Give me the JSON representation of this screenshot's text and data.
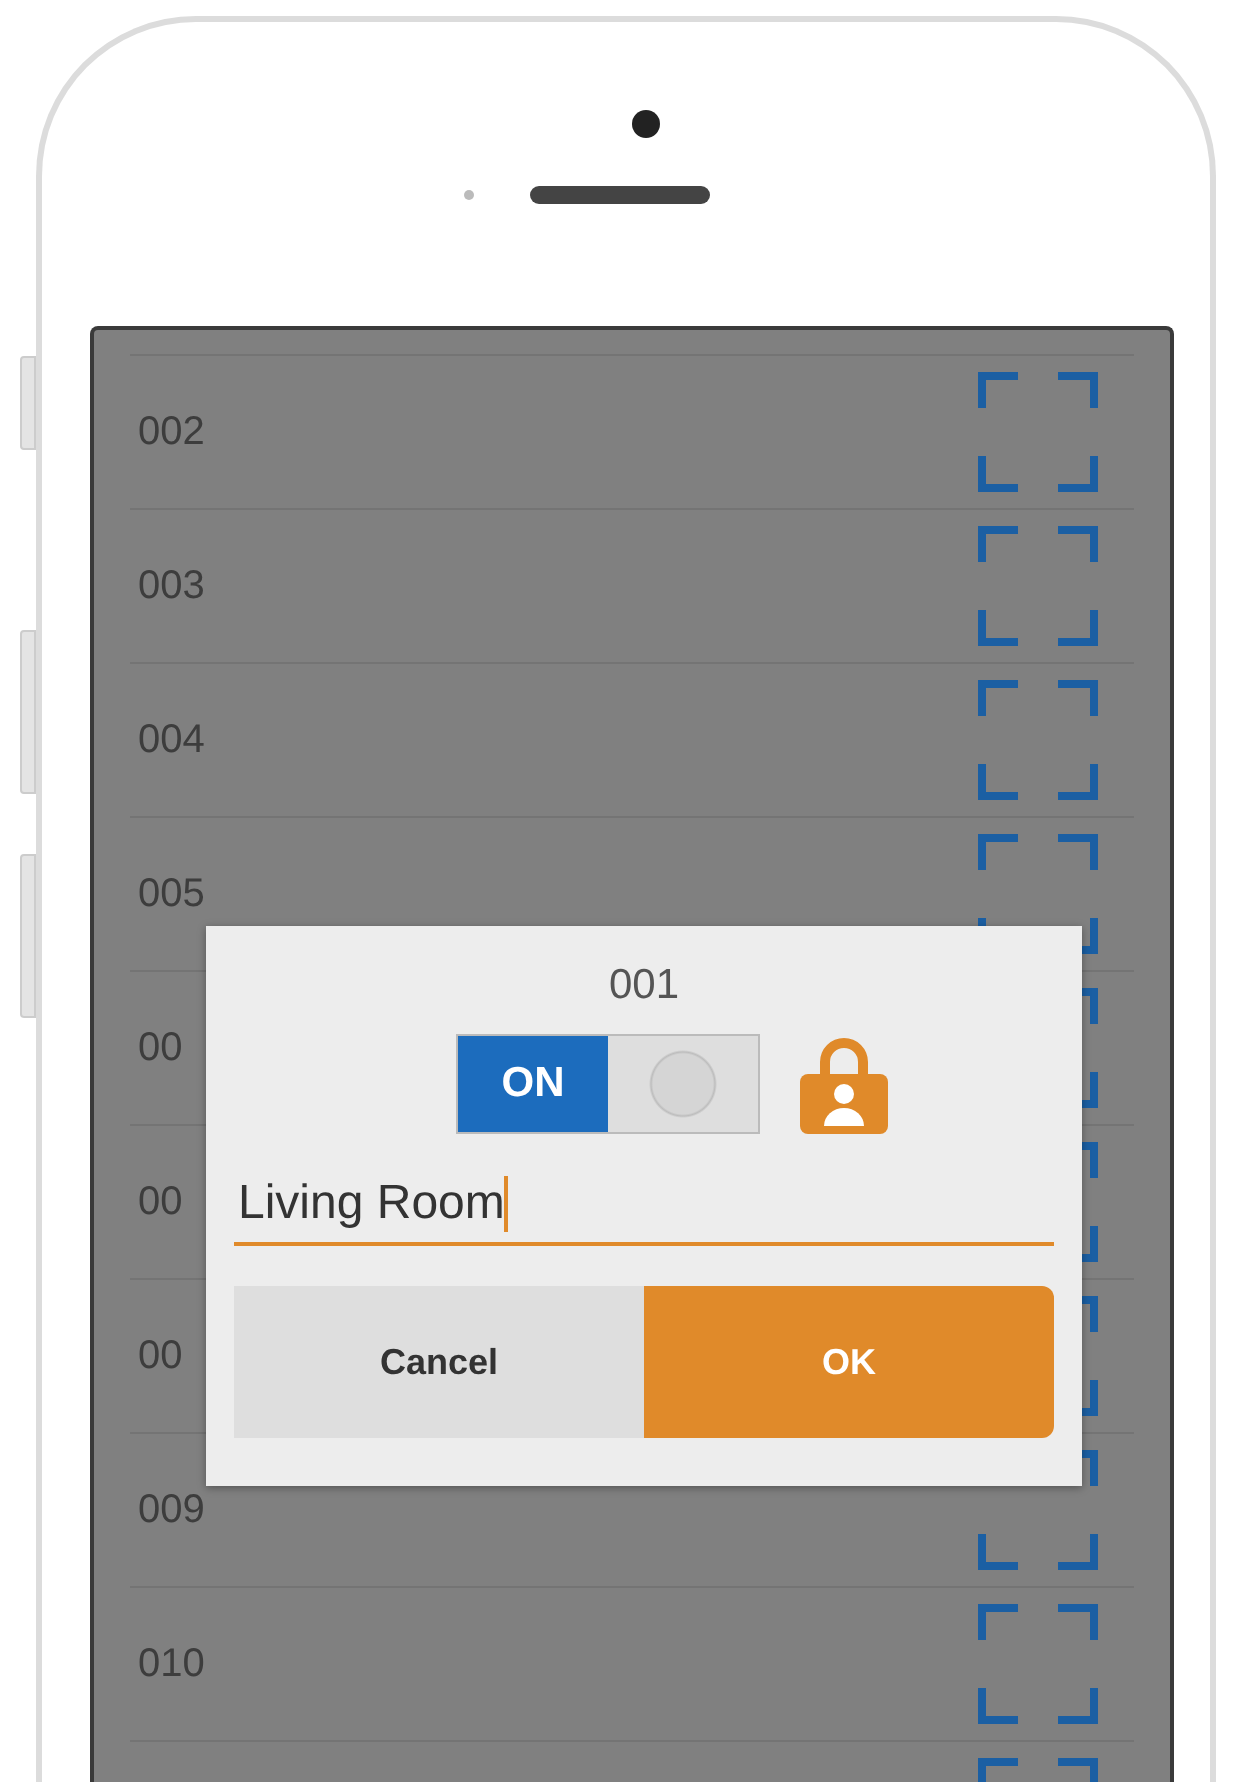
{
  "list": {
    "rows": [
      {
        "label": "002"
      },
      {
        "label": "003"
      },
      {
        "label": "004"
      },
      {
        "label": "005"
      },
      {
        "label": "00"
      },
      {
        "label": "00"
      },
      {
        "label": "00"
      },
      {
        "label": "009"
      },
      {
        "label": "010"
      },
      {}
    ]
  },
  "dialog": {
    "title": "001",
    "toggle": {
      "label": "ON",
      "on": true
    },
    "name_field": {
      "value": "Living Room",
      "focused": true
    },
    "buttons": [
      {
        "label": "Cancel",
        "kind": "secondary"
      },
      {
        "label": "OK",
        "kind": "primary"
      }
    ]
  }
}
